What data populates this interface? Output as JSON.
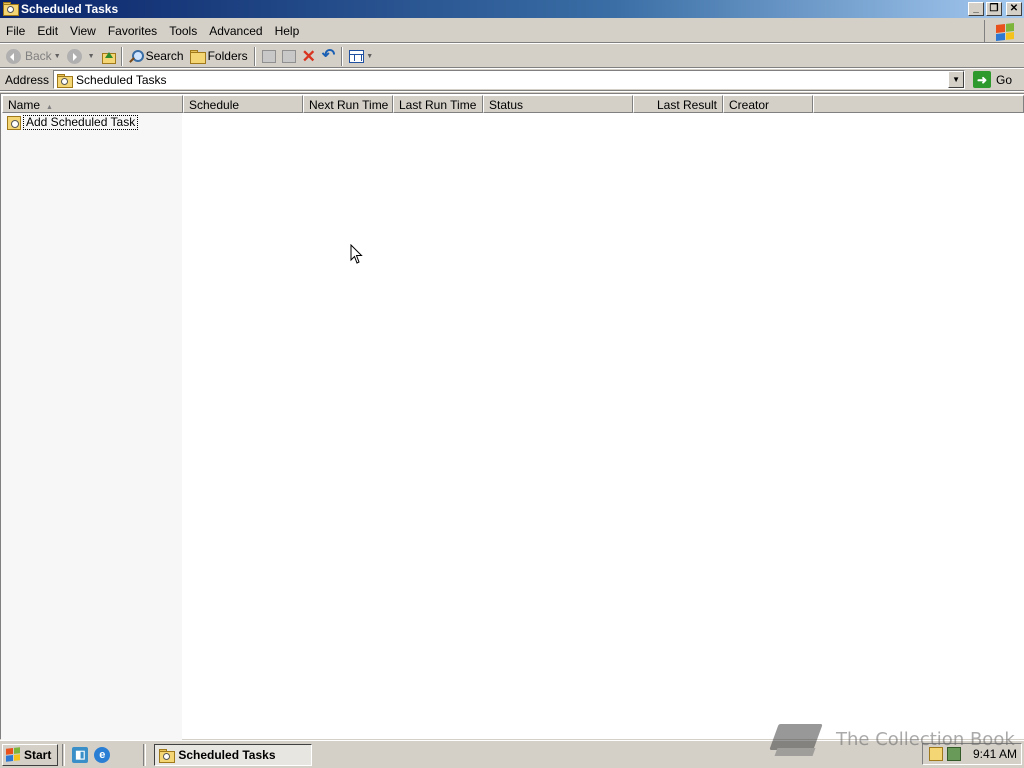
{
  "window": {
    "title": "Scheduled Tasks",
    "controls": {
      "minimize": "_",
      "restore": "❐",
      "close": "✕"
    }
  },
  "menubar": {
    "items": [
      {
        "label": "File",
        "accel": "F"
      },
      {
        "label": "Edit",
        "accel": "E"
      },
      {
        "label": "View",
        "accel": "V"
      },
      {
        "label": "Favorites",
        "accel": "a"
      },
      {
        "label": "Tools",
        "accel": "T"
      },
      {
        "label": "Advanced",
        "accel": "d"
      },
      {
        "label": "Help",
        "accel": "H"
      }
    ]
  },
  "toolbar": {
    "back_label": "Back",
    "search_label": "Search",
    "folders_label": "Folders"
  },
  "address": {
    "label": "Address",
    "value": "Scheduled Tasks",
    "go_label": "Go"
  },
  "columns": [
    "Name",
    "Schedule",
    "Next Run Time",
    "Last Run Time",
    "Status",
    "Last Result",
    "Creator"
  ],
  "items": [
    {
      "name": "Add Scheduled Task"
    }
  ],
  "taskbar": {
    "start_label": "Start",
    "active_task": "Scheduled Tasks",
    "clock": "9:41 AM"
  },
  "watermark": {
    "text": "The Collection Book"
  },
  "colors": {
    "title_gradient_start": "#0a246a",
    "title_gradient_end": "#a6caf0",
    "face": "#d4d0c8"
  }
}
